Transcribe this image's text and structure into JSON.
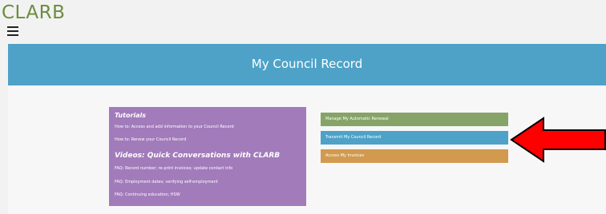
{
  "header": {
    "brand": "CLARB",
    "menu_icon": "hamburger-icon"
  },
  "hero": {
    "title": "My Council Record"
  },
  "tutorials": {
    "heading": "Tutorials",
    "links": [
      "How to: Access and add information to your Council Record",
      "How to: Renew your Council Record"
    ]
  },
  "videos": {
    "heading": "Videos: Quick Conversations with CLARB",
    "links": [
      "FAQ: Record number; re-print invoices; update contact info",
      "FAQ: Employment dates; verifying self-employment",
      "FAQ: Continuing education; HSW"
    ]
  },
  "actions": [
    {
      "label": "Manage My Automatic Renewal",
      "color": "#86a468"
    },
    {
      "label": "Transmit My Council Record",
      "color": "#4ea2c8"
    },
    {
      "label": "Access My Invoices",
      "color": "#d29a4e"
    }
  ],
  "annotation": {
    "icon": "red-arrow-icon",
    "color": "#ff0000"
  }
}
